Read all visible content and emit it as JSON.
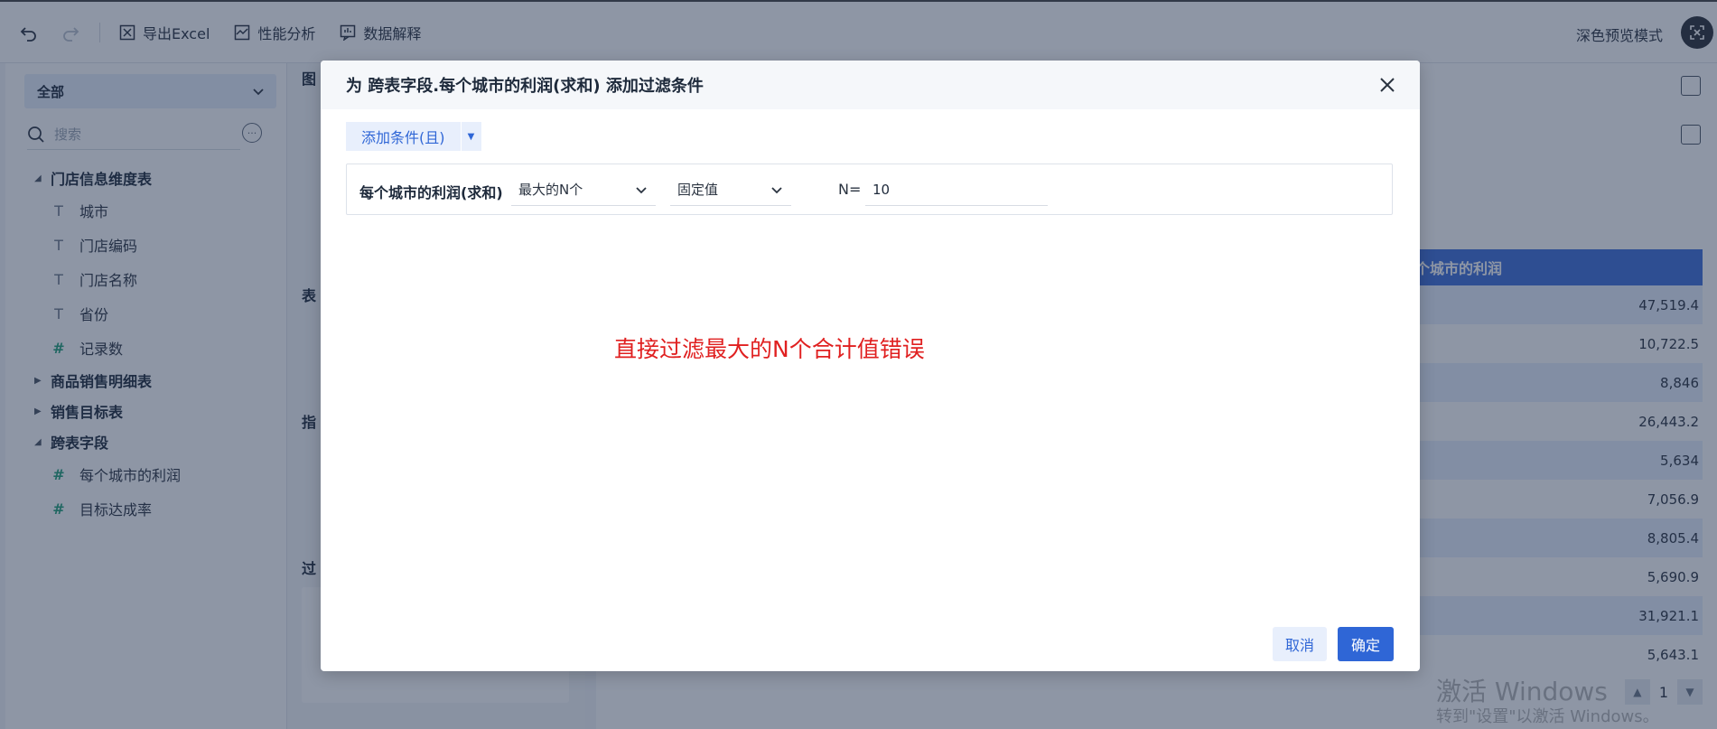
{
  "toolbar": {
    "export_label": "导出Excel",
    "perf_label": "性能分析",
    "explain_label": "数据解释",
    "dark_preview_label": "深色预览模式"
  },
  "sidebar": {
    "scope": "全部",
    "search_placeholder": "搜索",
    "more": "···",
    "groups": [
      {
        "label": "门店信息维度表",
        "leaves": [
          {
            "label": "城市",
            "icon": "T"
          },
          {
            "label": "门店编码",
            "icon": "T"
          },
          {
            "label": "门店名称",
            "icon": "T"
          },
          {
            "label": "省份",
            "icon": "T"
          },
          {
            "label": "记录数",
            "icon": "#"
          }
        ]
      },
      {
        "label": "商品销售明细表"
      },
      {
        "label": "销售目标表"
      },
      {
        "label": "跨表字段",
        "leaves": [
          {
            "label": "每个城市的利润",
            "icon": "#"
          },
          {
            "label": "目标达成率",
            "icon": "#"
          }
        ]
      }
    ]
  },
  "mid_panel": {
    "tu": "图",
    "biao": "表",
    "zhi": "指",
    "guo": "过"
  },
  "table": {
    "header": "个城市的利润",
    "values": [
      "47,519.4",
      "10,722.5",
      "8,846",
      "26,443.2",
      "5,634",
      "7,056.9",
      "8,805.4",
      "5,690.9",
      "31,921.1",
      "5,643.1"
    ]
  },
  "pager": {
    "page": "1"
  },
  "watermark": {
    "line1": "激活 Windows",
    "line2": "转到\"设置\"以激活 Windows。"
  },
  "dialog": {
    "title": "为 跨表字段.每个城市的利润(求和) 添加过滤条件",
    "add_condition": "添加条件(且)",
    "condition": {
      "field": "每个城市的利润(求和)",
      "operator": "最大的N个",
      "value_type": "固定值",
      "n_label": "N=",
      "n_value": "10"
    },
    "note": "直接过滤最大的N个合计值错误",
    "cancel": "取消",
    "ok": "确定"
  },
  "colors": {
    "accent": "#2f66d6",
    "note": "#e02020",
    "table_header": "#3f6fd8"
  }
}
